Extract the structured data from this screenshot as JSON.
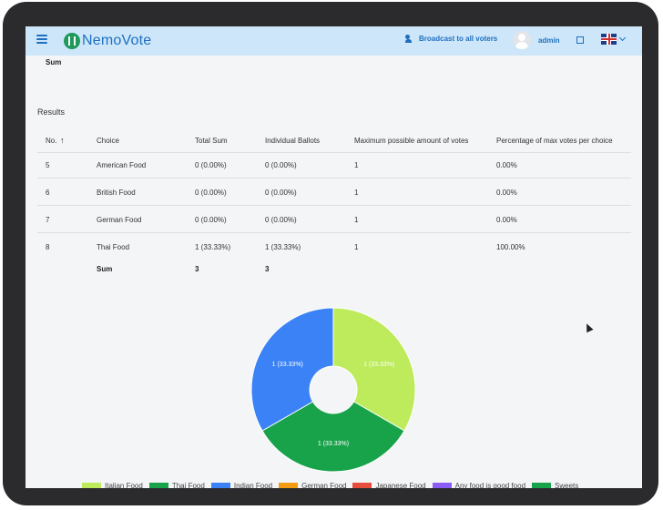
{
  "header": {
    "logo_text": "NemoVote",
    "broadcast_label": "Broadcast to all voters",
    "user_name": "admin"
  },
  "top_sum_label": "Sum",
  "results": {
    "title": "Results",
    "columns": [
      "No.",
      "Choice",
      "Total Sum",
      "Individual Ballots",
      "Maximum possible amount of votes",
      "Percentage of max votes per choice"
    ],
    "rows": [
      {
        "no": "5",
        "choice": "American Food",
        "total": "0 (0.00%)",
        "ballots": "0 (0.00%)",
        "max": "1",
        "pct": "0.00%"
      },
      {
        "no": "6",
        "choice": "British Food",
        "total": "0 (0.00%)",
        "ballots": "0 (0.00%)",
        "max": "1",
        "pct": "0.00%"
      },
      {
        "no": "7",
        "choice": "German Food",
        "total": "0 (0.00%)",
        "ballots": "0 (0.00%)",
        "max": "1",
        "pct": "0.00%"
      },
      {
        "no": "8",
        "choice": "Thai Food",
        "total": "1 (33.33%)",
        "ballots": "1 (33.33%)",
        "max": "1",
        "pct": "100.00%"
      }
    ],
    "sum_row": {
      "label": "Sum",
      "total": "3",
      "ballots": "3"
    }
  },
  "chart_data": {
    "type": "pie",
    "donut": true,
    "categories": [
      "Italian Food",
      "Thai Food",
      "Indian Food"
    ],
    "values": [
      1,
      1,
      1
    ],
    "labels": [
      "1 (33.33%)",
      "1 (33.33%)",
      "1 (33.33%)"
    ],
    "colors": [
      "#bdeb5b",
      "#18a34a",
      "#3b82f6"
    ],
    "legend_position": "bottom",
    "legend": [
      {
        "name": "Italian Food",
        "color": "#bdeb5b"
      },
      {
        "name": "Thai Food",
        "color": "#18a34a"
      },
      {
        "name": "Indian Food",
        "color": "#3b82f6"
      },
      {
        "name": "German Food",
        "color": "#f39c12"
      },
      {
        "name": "Japanese Food",
        "color": "#e74c3c"
      },
      {
        "name": "Any food is good food",
        "color": "#8b5cf6"
      },
      {
        "name": "Sweets",
        "color": "#16a34a"
      }
    ]
  }
}
